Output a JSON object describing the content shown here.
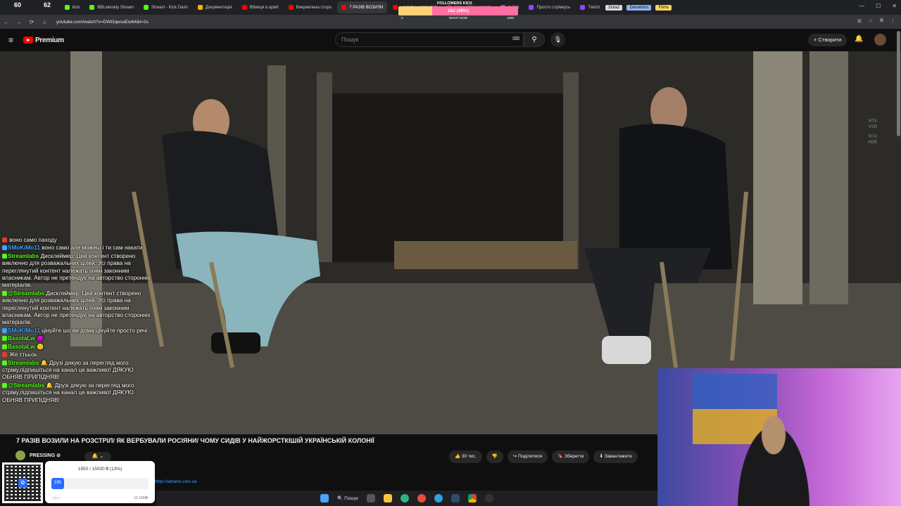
{
  "browser": {
    "tabs": [
      {
        "label": "kick",
        "color": "#53fc18"
      },
      {
        "label": "BBLwieskiy Stream",
        "color": "#53fc18"
      },
      {
        "label": "Stream - Kick Dash",
        "color": "#53fc18"
      },
      {
        "label": "Документація",
        "color": "#f4b400"
      },
      {
        "label": "Вбивця в армії",
        "color": "#ff0000"
      },
      {
        "label": "Викривлена сторо",
        "color": "#ff0000"
      },
      {
        "label": "7 РАЗІВ ВОЗИЛИ",
        "color": "#ff0000",
        "active": true
      },
      {
        "label": "youtube.com/watch",
        "color": "#ff0000"
      },
      {
        "label": "Чому війна з росія",
        "color": "#ff0000"
      },
      {
        "label": "twitch",
        "color": "#9146ff"
      },
      {
        "label": "Просто стрімкусь",
        "color": "#9146ff"
      },
      {
        "label": "Twitch",
        "color": "#9146ff"
      }
    ],
    "pills": [
      {
        "label": "Dota2",
        "color": "#d9d9d9"
      },
      {
        "label": "Donations",
        "color": "#8ab4f8"
      },
      {
        "label": "Films",
        "color": "#fdd663"
      }
    ],
    "window_controls": [
      "—",
      "☐",
      "✕"
    ],
    "url": "youtube.com/watch?v=DWGqwsaEw64&t=2s",
    "top_counter_a": "60",
    "top_counter_b": "62"
  },
  "youtube": {
    "logo_text": "Premium",
    "search_placeholder": "Пошук",
    "create_label": "+ Створити",
    "video_badges": [
      "RTX",
      "VSR",
      "RTX",
      "HDR"
    ],
    "title": "7 РАЗІВ ВОЗИЛИ НА РОЗСТРІЛ/ ЯК ВЕРБУВАЛИ РОСІЯНИ/ ЧОМУ СИДІВ У НАЙЖОРСТКІШІЙ УКРАЇНСЬКІЙ КОЛОНІЇ",
    "channel_name": "PRESSING ⊘",
    "actions": [
      {
        "icon": "like-icon",
        "label": "👍 30 тис."
      },
      {
        "icon": "dislike-icon",
        "label": "👎"
      },
      {
        "icon": "share-icon",
        "label": "↪ Поділитися"
      },
      {
        "icon": "save-icon",
        "label": "🔖 Зберегти"
      },
      {
        "icon": "download-icon",
        "label": "⬇ Завантажити"
      }
    ],
    "desc_link": "https://abrams.com.ua"
  },
  "chat": [
    {
      "user": "",
      "color": "#e53935",
      "text": "воно само паходу"
    },
    {
      "user": "SMoKiMo11",
      "color": "#3ea6ff",
      "text": "воно само але можеш і ти сам накати"
    },
    {
      "user": "Streamlabs",
      "color": "#53fc18",
      "text": "Дисклеймер: Цей контент створено виключно для розважальних цілей. Усі права на переглянутий контент належать їхнім законним власникам. Автор не претендує на авторство сторонніх матеріалів."
    },
    {
      "user": "@Streamlabs",
      "color": "#53fc18",
      "text": "Дисклеймер: Цей контент створено виключно для розважальних цілей. Усі права на переглянутий контент належать їхнім законним власникам. Автор не претендує на авторство сторонніх матеріалів."
    },
    {
      "user": "SMoKiMo11",
      "color": "#3ea6ff",
      "text": "цінуйте шо ви дома цінуйте просто речі"
    },
    {
      "user": "BasotaLw",
      "color": "#53fc18",
      "text": "😈"
    },
    {
      "user": "BasotaLw",
      "color": "#53fc18",
      "text": "🙂"
    },
    {
      "user": "",
      "color": "#e53935",
      "text": "Же стььоь"
    },
    {
      "user": "Streamlabs",
      "color": "#53fc18",
      "text": "🔔 Друзі дякую за перегляд мого стріму,підпишіться на канал це важливо! ДЯКУЮ ОБНЯВ ПРИПІДНЯВ!"
    },
    {
      "user": "@Streamlabs",
      "color": "#53fc18",
      "text": "🔔 Друзі дякую за перегляд мого стріму,підпишіться на канал це важливо! ДЯКУЮ ОБНЯВ ПРИПІДНЯВ!"
    }
  ],
  "followers_widget": {
    "title": "FOLLOWERS KICK",
    "count": "282 (28%)",
    "progress": 0.28,
    "now_label": "RIGHT NOW",
    "min": "0",
    "max": "1000"
  },
  "donation_widget": {
    "text": "1950 / 15000 ₴ (13%)",
    "progress": 0.13,
    "fill_text": "195",
    "label": "Ціль:",
    "goal": "15 000₴"
  },
  "taskbar": {
    "search_label": "🔍 Пошук"
  }
}
